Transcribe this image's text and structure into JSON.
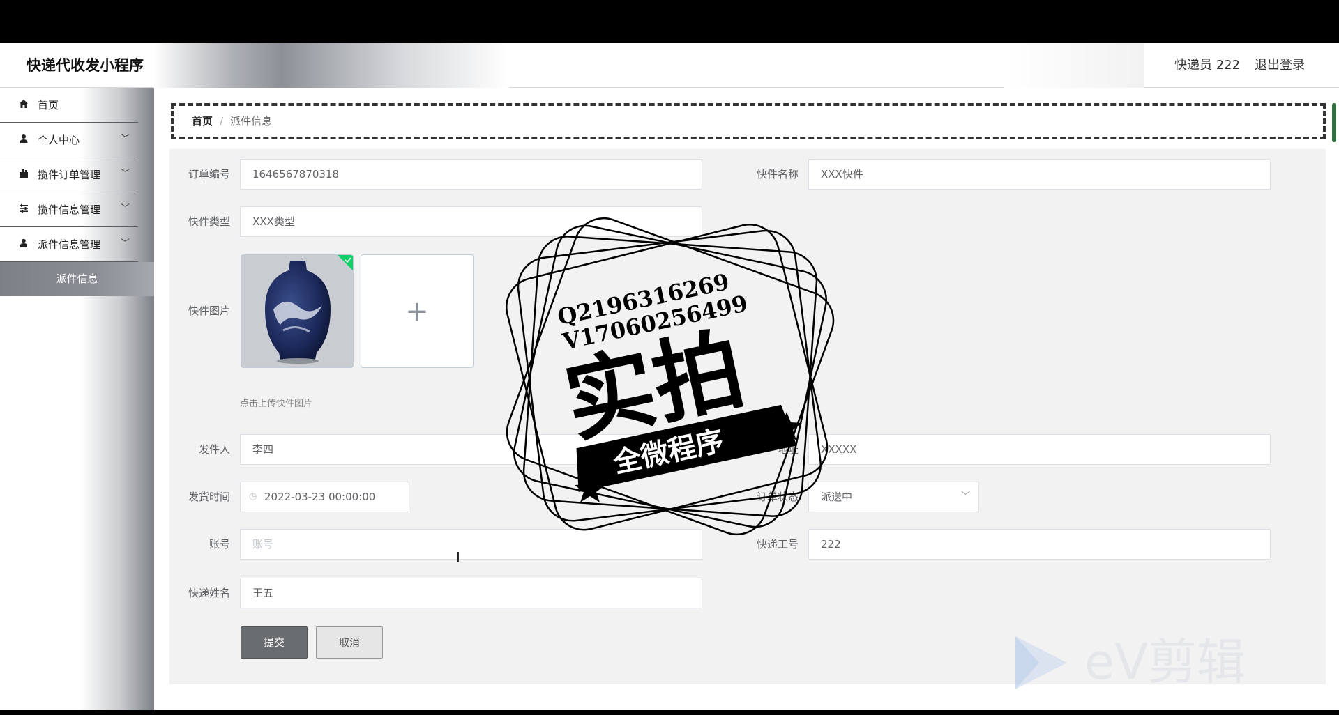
{
  "header": {
    "app_title": "快递代收发小程序",
    "user_name": "快递员 222",
    "logout": "退出登录"
  },
  "sidebar": {
    "items": [
      {
        "label": "首页",
        "icon": "home-icon",
        "has_children": false
      },
      {
        "label": "个人中心",
        "icon": "user-icon",
        "has_children": true
      },
      {
        "label": "揽件订单管理",
        "icon": "order-icon",
        "has_children": true
      },
      {
        "label": "揽件信息管理",
        "icon": "sliders-icon",
        "has_children": true
      },
      {
        "label": "派件信息管理",
        "icon": "person-icon",
        "has_children": true
      }
    ],
    "active_sub": "派件信息"
  },
  "breadcrumb": {
    "home": "首页",
    "current": "派件信息",
    "separator": "/"
  },
  "form": {
    "order_no": {
      "label": "订单编号",
      "value": "1646567870318"
    },
    "item_name": {
      "label": "快件名称",
      "value": "XXX快件"
    },
    "item_type": {
      "label": "快件类型",
      "value": "XXX类型"
    },
    "item_image": {
      "label": "快件图片",
      "tip": "点击上传快件图片",
      "add_glyph": "+"
    },
    "sender": {
      "label": "发件人",
      "value": "李四"
    },
    "address": {
      "label": "地址",
      "value": "XXXXX"
    },
    "ship_time": {
      "label": "发货时间",
      "value": "2022-03-23 00:00:00",
      "icon": "clock-icon"
    },
    "order_status": {
      "label": "订单状态",
      "value": "派送中"
    },
    "account": {
      "label": "账号",
      "placeholder": "账号"
    },
    "courier_id": {
      "label": "快递工号",
      "value": "222"
    },
    "courier_name": {
      "label": "快递姓名",
      "value": "王五"
    },
    "submit": "提交",
    "cancel": "取消"
  },
  "watermark": {
    "line1": "Q2196316269",
    "line2": "V17060256499",
    "big": "实拍",
    "ribbon": "全微程序",
    "ev_brand": "eV剪辑"
  }
}
